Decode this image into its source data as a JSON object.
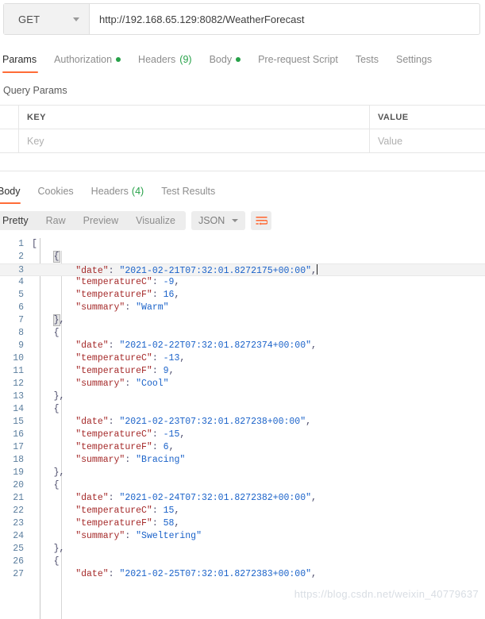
{
  "request": {
    "method": "GET",
    "url": "http://192.168.65.129:8082/WeatherForecast",
    "tabs": [
      {
        "label": "Params",
        "active": true,
        "dot": false,
        "count": ""
      },
      {
        "label": "Authorization",
        "active": false,
        "dot": true,
        "count": ""
      },
      {
        "label": "Headers",
        "active": false,
        "dot": false,
        "count": "(9)"
      },
      {
        "label": "Body",
        "active": false,
        "dot": true,
        "count": ""
      },
      {
        "label": "Pre-request Script",
        "active": false,
        "dot": false,
        "count": ""
      },
      {
        "label": "Tests",
        "active": false,
        "dot": false,
        "count": ""
      },
      {
        "label": "Settings",
        "active": false,
        "dot": false,
        "count": ""
      }
    ]
  },
  "query_params": {
    "title": "Query Params",
    "columns": {
      "key": "KEY",
      "value": "VALUE"
    },
    "row": {
      "key_placeholder": "Key",
      "value_placeholder": "Value"
    }
  },
  "response": {
    "tabs": [
      {
        "label": "Body",
        "active": true,
        "count": ""
      },
      {
        "label": "Cookies",
        "active": false,
        "count": ""
      },
      {
        "label": "Headers",
        "active": false,
        "count": "(4)"
      },
      {
        "label": "Test Results",
        "active": false,
        "count": ""
      }
    ],
    "view_modes": [
      {
        "label": "Pretty",
        "active": true
      },
      {
        "label": "Raw",
        "active": false
      },
      {
        "label": "Preview",
        "active": false
      },
      {
        "label": "Visualize",
        "active": false
      }
    ],
    "format": "JSON",
    "wrap_icon": "wrap-lines-icon"
  },
  "body_lines": [
    {
      "n": 1,
      "indent": 0,
      "type": "open-array",
      "text": "["
    },
    {
      "n": 2,
      "indent": 1,
      "type": "open-brace",
      "text": "{"
    },
    {
      "n": 3,
      "indent": 2,
      "type": "kv-string",
      "key": "date",
      "value": "2021-02-21T07:32:01.8272175+00:00",
      "comma": true,
      "caret": true,
      "highlight": true
    },
    {
      "n": 4,
      "indent": 2,
      "type": "kv-number",
      "key": "temperatureC",
      "value": "-9",
      "comma": true
    },
    {
      "n": 5,
      "indent": 2,
      "type": "kv-number",
      "key": "temperatureF",
      "value": "16",
      "comma": true
    },
    {
      "n": 6,
      "indent": 2,
      "type": "kv-string",
      "key": "summary",
      "value": "Warm",
      "comma": false
    },
    {
      "n": 7,
      "indent": 1,
      "type": "close-brace",
      "text": "},",
      "match": true
    },
    {
      "n": 8,
      "indent": 1,
      "type": "open-brace",
      "text": "{"
    },
    {
      "n": 9,
      "indent": 2,
      "type": "kv-string",
      "key": "date",
      "value": "2021-02-22T07:32:01.8272374+00:00",
      "comma": true
    },
    {
      "n": 10,
      "indent": 2,
      "type": "kv-number",
      "key": "temperatureC",
      "value": "-13",
      "comma": true
    },
    {
      "n": 11,
      "indent": 2,
      "type": "kv-number",
      "key": "temperatureF",
      "value": "9",
      "comma": true
    },
    {
      "n": 12,
      "indent": 2,
      "type": "kv-string",
      "key": "summary",
      "value": "Cool",
      "comma": false
    },
    {
      "n": 13,
      "indent": 1,
      "type": "close-brace",
      "text": "},"
    },
    {
      "n": 14,
      "indent": 1,
      "type": "open-brace",
      "text": "{"
    },
    {
      "n": 15,
      "indent": 2,
      "type": "kv-string",
      "key": "date",
      "value": "2021-02-23T07:32:01.827238+00:00",
      "comma": true
    },
    {
      "n": 16,
      "indent": 2,
      "type": "kv-number",
      "key": "temperatureC",
      "value": "-15",
      "comma": true
    },
    {
      "n": 17,
      "indent": 2,
      "type": "kv-number",
      "key": "temperatureF",
      "value": "6",
      "comma": true
    },
    {
      "n": 18,
      "indent": 2,
      "type": "kv-string",
      "key": "summary",
      "value": "Bracing",
      "comma": false
    },
    {
      "n": 19,
      "indent": 1,
      "type": "close-brace",
      "text": "},"
    },
    {
      "n": 20,
      "indent": 1,
      "type": "open-brace",
      "text": "{"
    },
    {
      "n": 21,
      "indent": 2,
      "type": "kv-string",
      "key": "date",
      "value": "2021-02-24T07:32:01.8272382+00:00",
      "comma": true
    },
    {
      "n": 22,
      "indent": 2,
      "type": "kv-number",
      "key": "temperatureC",
      "value": "15",
      "comma": true
    },
    {
      "n": 23,
      "indent": 2,
      "type": "kv-number",
      "key": "temperatureF",
      "value": "58",
      "comma": true
    },
    {
      "n": 24,
      "indent": 2,
      "type": "kv-string",
      "key": "summary",
      "value": "Sweltering",
      "comma": false
    },
    {
      "n": 25,
      "indent": 1,
      "type": "close-brace",
      "text": "},"
    },
    {
      "n": 26,
      "indent": 1,
      "type": "open-brace",
      "text": "{"
    },
    {
      "n": 27,
      "indent": 2,
      "type": "kv-string",
      "key": "date",
      "value": "2021-02-25T07:32:01.8272383+00:00",
      "comma": true
    }
  ],
  "watermark": "https://blog.csdn.net/weixin_40779637",
  "colors": {
    "accent": "#ff6c37",
    "green": "#26a148",
    "json_key": "#a52a2a",
    "json_string": "#1a62c9",
    "line_number": "#5b7e9e"
  }
}
